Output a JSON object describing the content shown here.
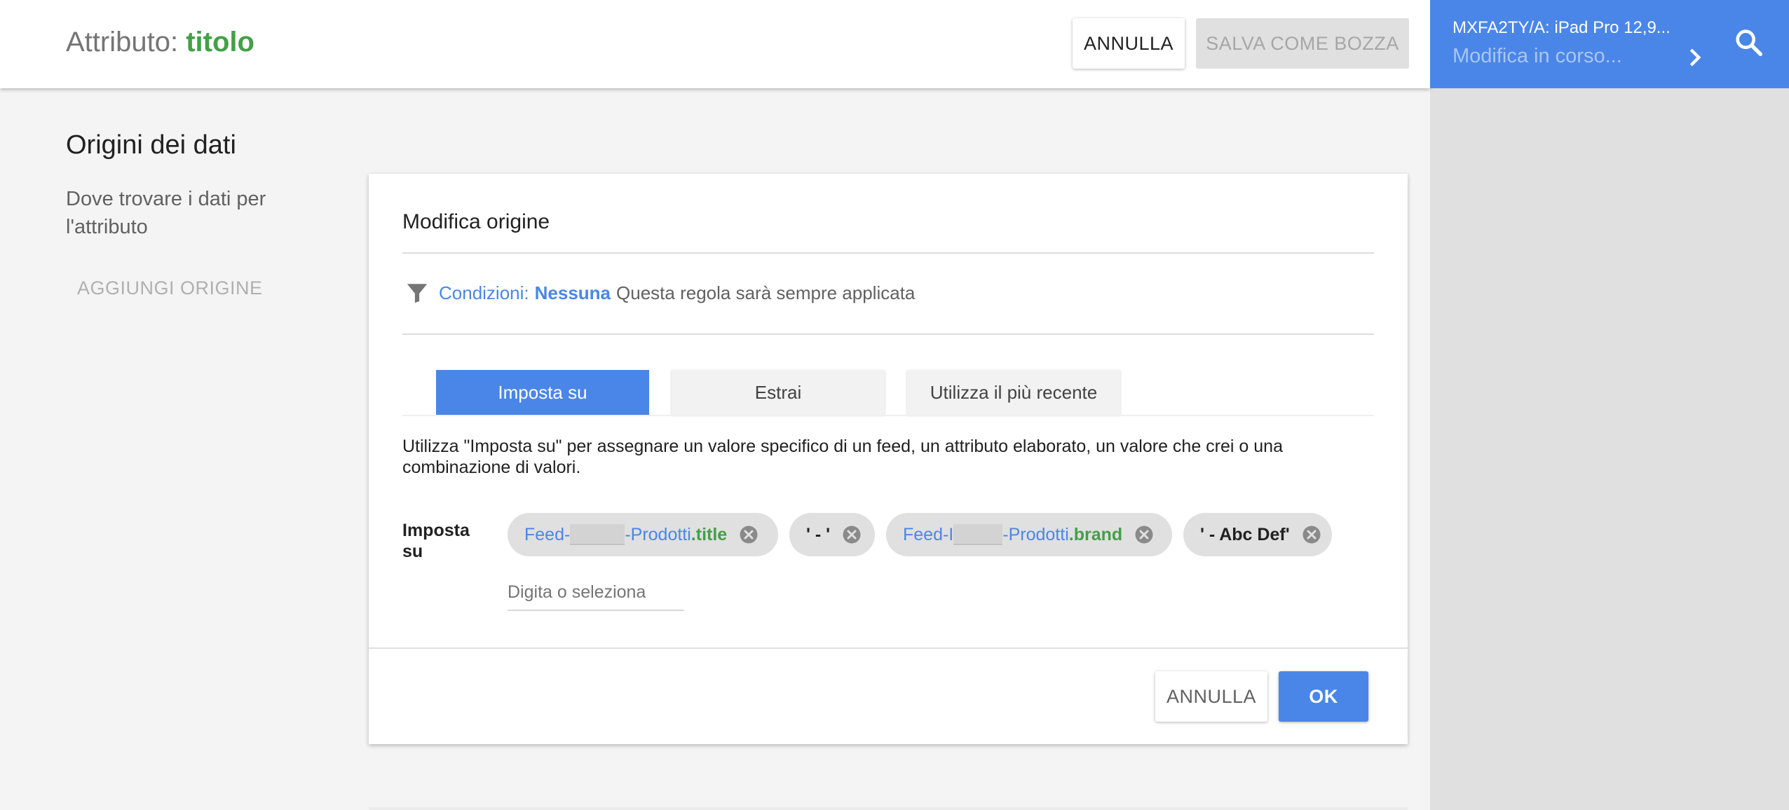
{
  "header": {
    "title_prefix": "Attributo:",
    "attribute_name": "titolo",
    "cancel_label": "ANNULLA",
    "save_draft_label": "SALVA COME BOZZA"
  },
  "side_panel": {
    "device": "MXFA2TY/A: iPad Pro 12,9...",
    "status": "Modifica in corso..."
  },
  "sources": {
    "title": "Origini dei dati",
    "description": "Dove trovare i dati per l'attributo",
    "add_label": "AGGIUNGI ORIGINE"
  },
  "editor": {
    "title": "Modifica origine",
    "conditions_label": "Condizioni:",
    "conditions_value": "Nessuna",
    "conditions_desc": "Questa regola sarà sempre applicata",
    "tabs": [
      {
        "label": "Imposta su",
        "active": true
      },
      {
        "label": "Estrai",
        "active": false
      },
      {
        "label": "Utilizza il più recente",
        "active": false
      }
    ],
    "help_text": "Utilizza \"Imposta su\" per assegnare un valore specifico di un feed, un attributo elaborato, un valore che crei o una combinazione di valori.",
    "set_to_label": "Imposta su",
    "chips": [
      {
        "feed_prefix": "Feed-",
        "feed_suffix": "-Prodotti",
        "field": ".title"
      },
      {
        "literal": "' - '"
      },
      {
        "feed_prefix": "Feed-I",
        "feed_suffix": "-Prodotti",
        "field": ".brand"
      },
      {
        "literal": "' - Abc Def'"
      }
    ],
    "input_placeholder": "Digita o seleziona",
    "cancel_label": "ANNULLA",
    "ok_label": "OK"
  },
  "colors": {
    "primary_blue": "#4a86e8",
    "green": "#43a047",
    "side_panel_bg": "#e0e0e0"
  },
  "icons": [
    "chevron-right-icon",
    "search-icon",
    "filter-icon",
    "close-circle-icon"
  ]
}
